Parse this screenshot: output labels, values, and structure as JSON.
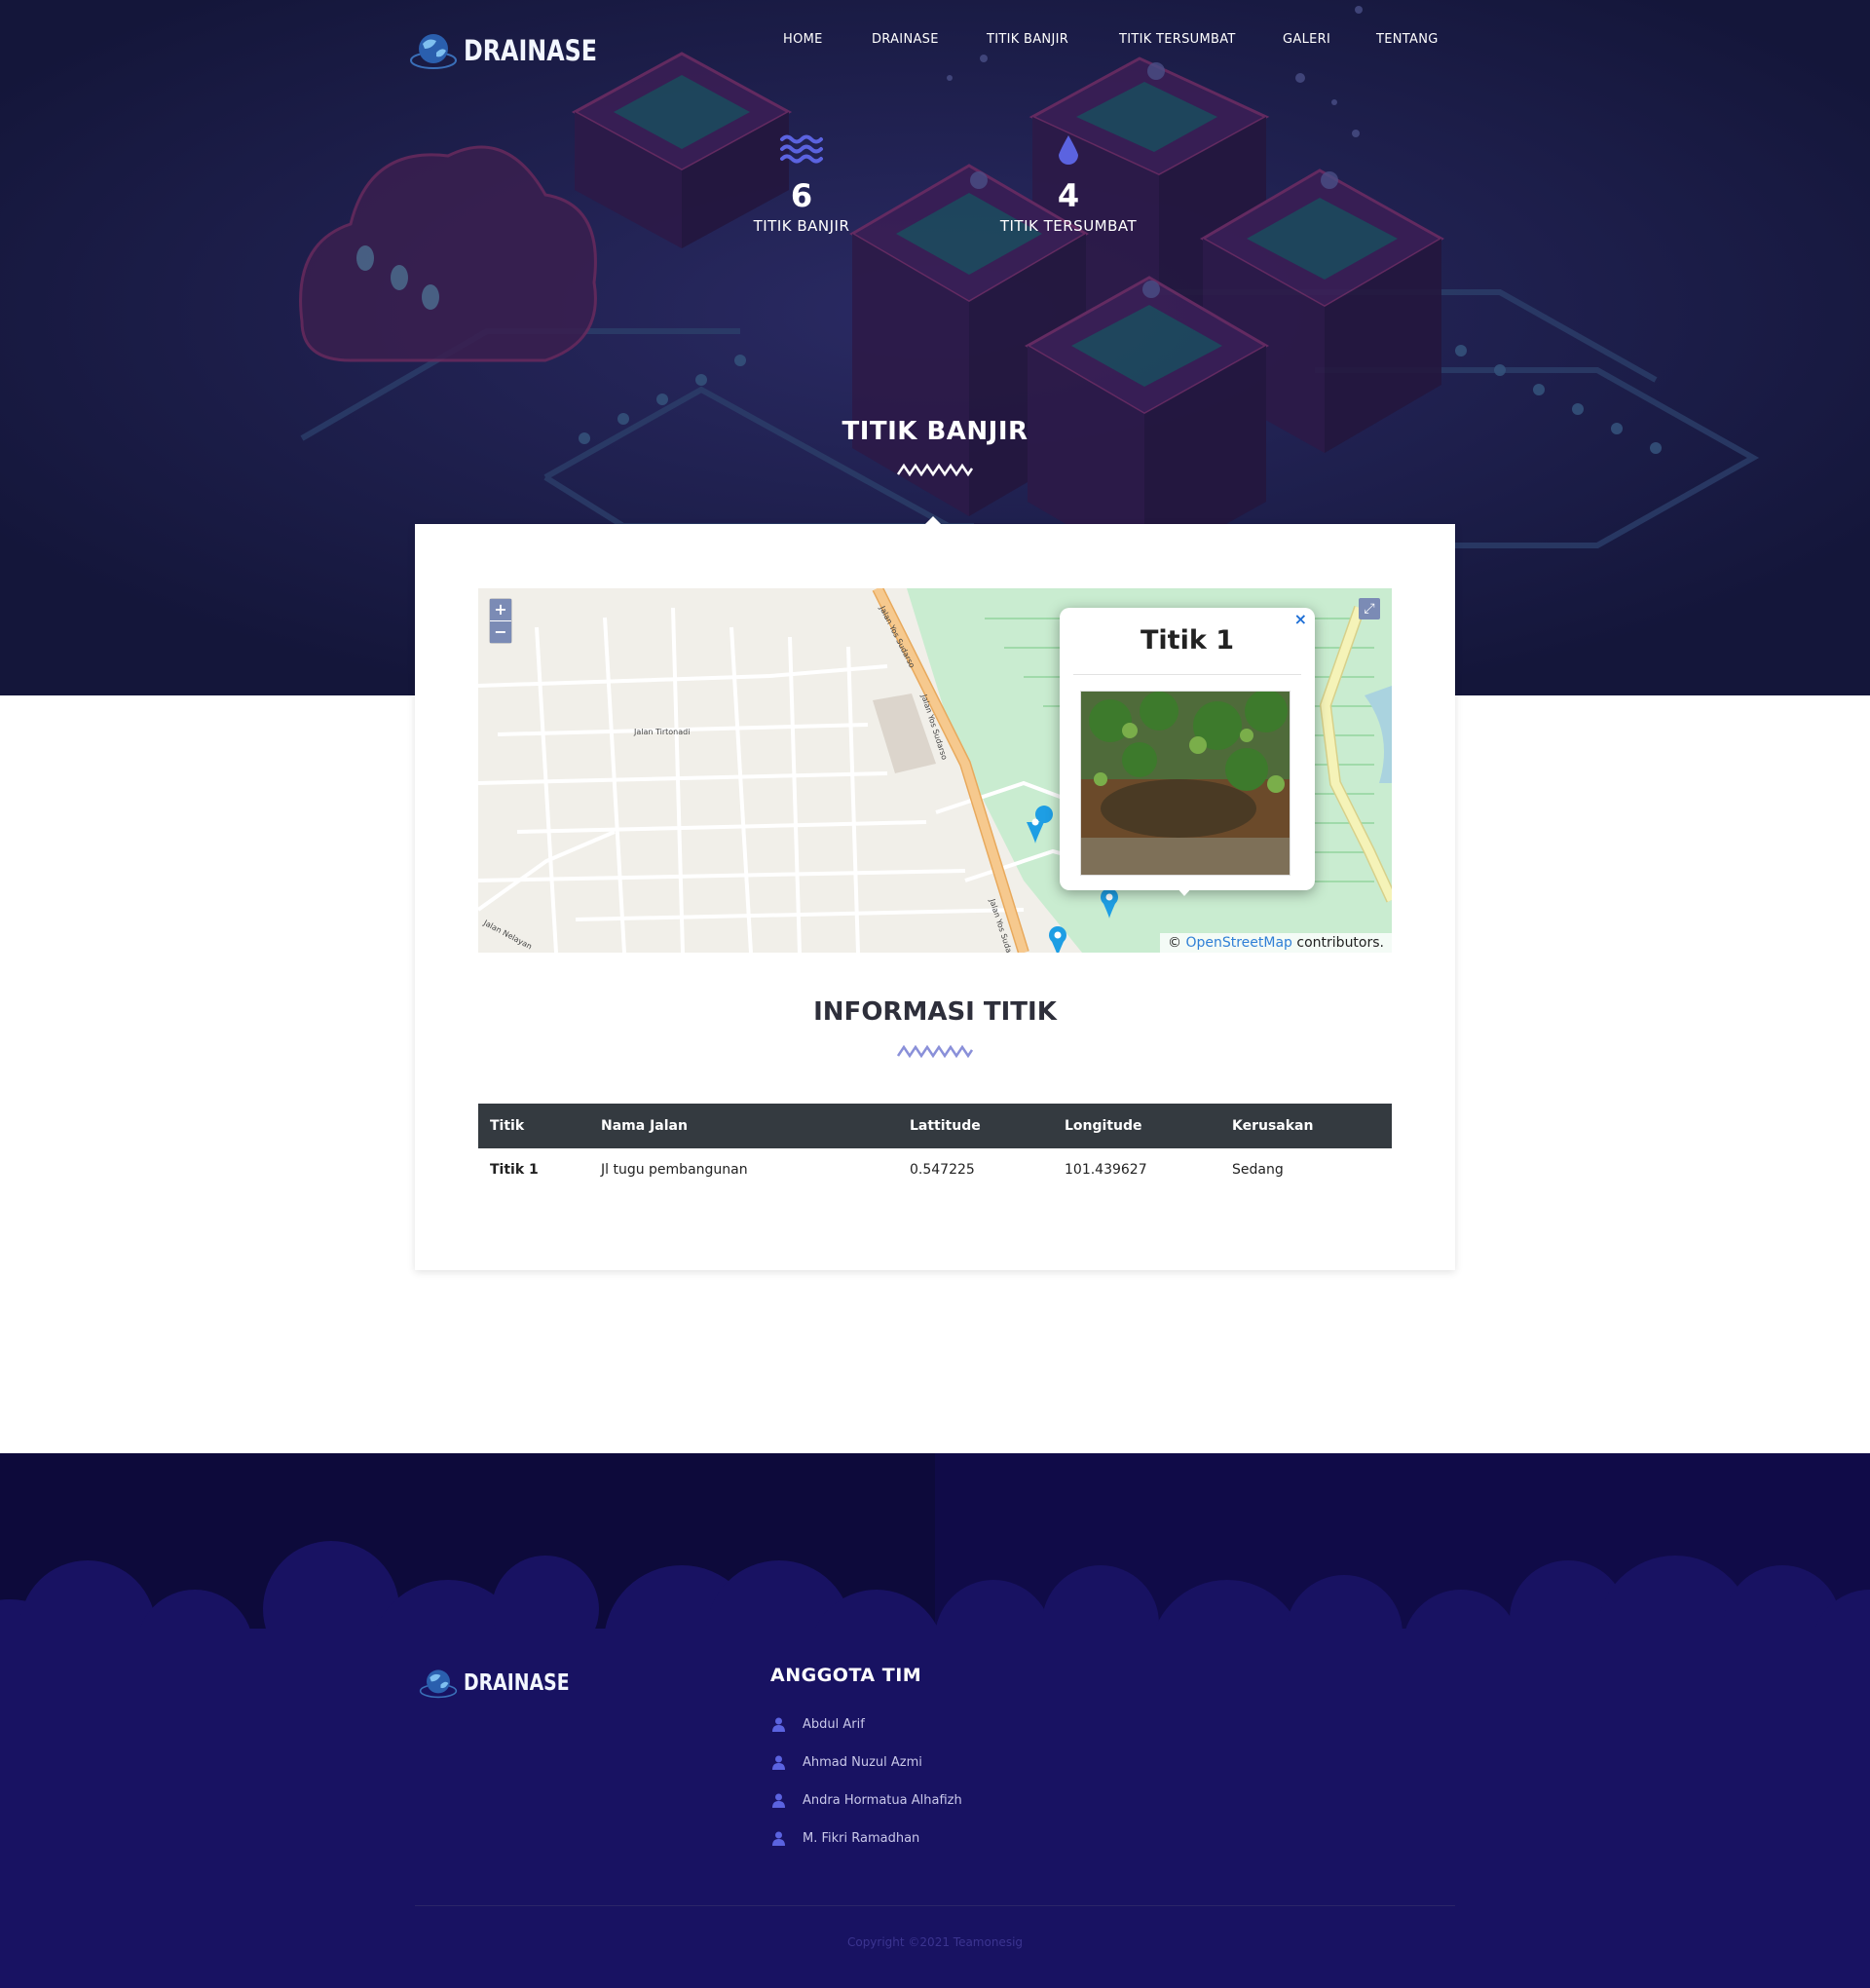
{
  "brand": {
    "name": "DRAINASE"
  },
  "nav": {
    "items": [
      {
        "label": "HOME"
      },
      {
        "label": "DRAINASE"
      },
      {
        "label": "TITIK BANJIR"
      },
      {
        "label": "TITIK TERSUMBAT"
      },
      {
        "label": "GALERI"
      },
      {
        "label": "TENTANG"
      }
    ]
  },
  "stats": [
    {
      "icon": "waves-icon",
      "value": "6",
      "label": "TITIK BANJIR"
    },
    {
      "icon": "water-drop-icon",
      "value": "4",
      "label": "TITIK TERSUMBAT"
    }
  ],
  "hero": {
    "title": "TITIK BANJIR"
  },
  "map": {
    "zoom_in": "+",
    "zoom_out": "−",
    "fullscreen_icon": "expand-icon",
    "street_labels": [
      "Jalan Tirtonadi",
      "Jalan Yos Sudarso",
      "Jalan Yos Sudarso",
      "Jalan Yos Sudarso",
      "Jalan Nelayan"
    ],
    "popup": {
      "title": "Titik 1",
      "close": "×"
    },
    "attribution": {
      "prefix": "©",
      "link": "OpenStreetMap",
      "suffix": "contributors."
    }
  },
  "info": {
    "title": "INFORMASI TITIK",
    "columns": [
      "Titik",
      "Nama Jalan",
      "Lattitude",
      "Longitude",
      "Kerusakan"
    ],
    "rows": [
      {
        "titik": "Titik 1",
        "nama_jalan": "Jl tugu pembangunan",
        "latitude": "0.547225",
        "longitude": "101.439627",
        "kerusakan": "Sedang"
      }
    ]
  },
  "footer": {
    "brand": "DRAINASE",
    "team_title": "ANGGOTA TIM",
    "members": [
      "Abdul Arif",
      "Ahmad Nuzul Azmi",
      "Andra Hormatua Alhafizh",
      "M. Fikri Ramadhan"
    ],
    "copyright": "Copyright ©2021 Teamonesig"
  },
  "colors": {
    "hero_bg": "#16183d",
    "footer_bg": "#140e52",
    "accent": "#4f5bd5",
    "table_header": "#343a40",
    "link": "#2f7fd6"
  }
}
